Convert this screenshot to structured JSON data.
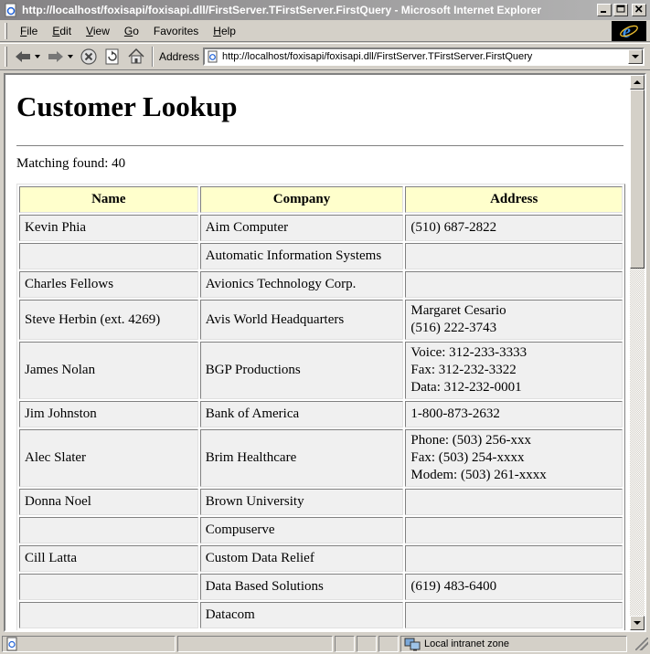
{
  "window": {
    "title": "http://localhost/foxisapi/foxisapi.dll/FirstServer.TFirstServer.FirstQuery - Microsoft Internet Explorer",
    "minimize": "_",
    "maximize": "□",
    "close": "×"
  },
  "menu": {
    "items": [
      {
        "key": "F",
        "rest": "ile"
      },
      {
        "key": "E",
        "rest": "dit"
      },
      {
        "key": "V",
        "rest": "iew"
      },
      {
        "key": "G",
        "rest": "o"
      },
      {
        "key": "",
        "rest": "Favorites"
      },
      {
        "key": "H",
        "rest": "elp"
      }
    ]
  },
  "toolbar": {
    "address_label": "Address",
    "address_value": "http://localhost/foxisapi/foxisapi.dll/FirstServer.TFirstServer.FirstQuery"
  },
  "page": {
    "heading": "Customer Lookup",
    "match_text": "Matching found: 40",
    "columns": [
      "Name",
      "Company",
      "Address"
    ],
    "rows": [
      {
        "name": "Kevin Phia",
        "company": "Aim Computer",
        "address": [
          "(510) 687-2822"
        ]
      },
      {
        "name": "",
        "company": "Automatic Information Systems",
        "address": []
      },
      {
        "name": "Charles Fellows",
        "company": "Avionics Technology Corp.",
        "address": []
      },
      {
        "name": "Steve Herbin (ext. 4269)",
        "company": "Avis World Headquarters",
        "address": [
          "Margaret Cesario",
          "(516) 222-3743"
        ]
      },
      {
        "name": "James Nolan",
        "company": "BGP Productions",
        "address": [
          "Voice: 312-233-3333",
          "Fax: 312-232-3322",
          "Data: 312-232-0001"
        ]
      },
      {
        "name": "Jim Johnston",
        "company": "Bank of America",
        "address": [
          "1-800-873-2632"
        ]
      },
      {
        "name": "Alec Slater",
        "company": "Brim Healthcare",
        "address": [
          "Phone: (503) 256-xxx",
          "Fax: (503) 254-xxxx",
          "Modem: (503) 261-xxxx"
        ]
      },
      {
        "name": "Donna Noel",
        "company": "Brown University",
        "address": []
      },
      {
        "name": "",
        "company": "Compuserve",
        "address": []
      },
      {
        "name": "Cill Latta",
        "company": "Custom Data Relief",
        "address": []
      },
      {
        "name": "",
        "company": "Data Based Solutions",
        "address": [
          "(619) 483-6400"
        ]
      },
      {
        "name": "",
        "company": "Datacom",
        "address": []
      }
    ]
  },
  "status": {
    "zone": "Local intranet zone"
  },
  "colors": {
    "header_bg": "#ffffcc",
    "cell_bg": "#f0f0f0",
    "chrome": "#d4d0c8"
  }
}
